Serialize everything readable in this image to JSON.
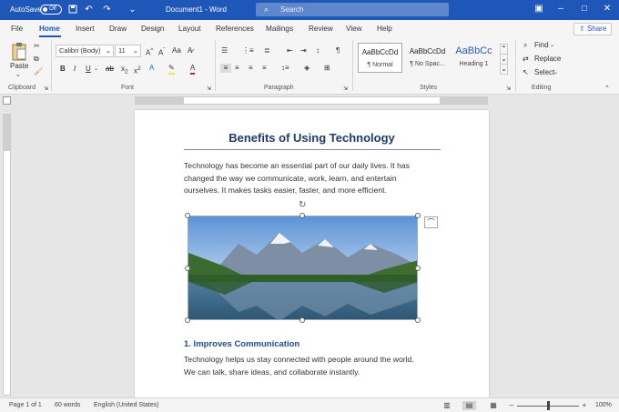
{
  "titlebar": {
    "autosave_label": "AutoSave",
    "autosave_state": "Off",
    "doc_title": "Document1 - Word",
    "search_placeholder": "Search"
  },
  "tabs": [
    "File",
    "Home",
    "Insert",
    "Draw",
    "Design",
    "Layout",
    "References",
    "Mailings",
    "Review",
    "View",
    "Help"
  ],
  "active_tab": "Home",
  "share_label": "Share",
  "ribbon": {
    "clipboard": {
      "paste_label": "Paste",
      "group_label": "Clipboard"
    },
    "font": {
      "font_name": "Calibri (Body)",
      "font_size": "11",
      "group_label": "Font"
    },
    "paragraph": {
      "group_label": "Paragraph"
    },
    "styles": {
      "group_label": "Styles",
      "items": [
        {
          "sample": "AaBbCcDd",
          "name": "¶ Normal"
        },
        {
          "sample": "AaBbCcDd",
          "name": "¶ No Spac..."
        },
        {
          "sample": "AaBbCc",
          "name": "Heading 1"
        }
      ]
    },
    "editing": {
      "group_label": "Editing",
      "find_label": "Find",
      "replace_label": "Replace",
      "select_label": "Select"
    }
  },
  "document": {
    "heading": "Benefits of Using Technology",
    "intro_lines": [
      "Technology has become an essential part of our daily lives. It has",
      "changed the way we communicate, work, learn, and entertain",
      "ourselves. It makes tasks easier, faster, and more efficient."
    ],
    "subheading": "1. Improves Communication",
    "section_lines": [
      "Technology helps us stay connected with people around the world.",
      "We can talk, share ideas, and collaborate instantly."
    ]
  },
  "status": {
    "page": "Page 1 of 1",
    "words": "60 words",
    "language": "English (United States)",
    "zoom": "100%"
  },
  "colors": {
    "accent": "#1e57b8",
    "heading": "#1f3a6b",
    "subheading": "#1f4a8c"
  }
}
